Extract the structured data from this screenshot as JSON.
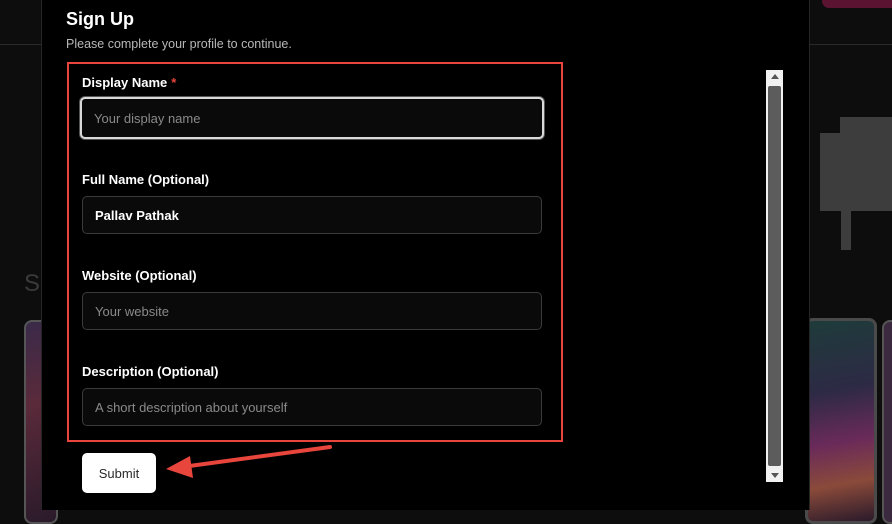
{
  "modal": {
    "title": "Sign Up",
    "subtitle": "Please complete your profile to continue."
  },
  "form": {
    "display_name": {
      "label": "Display Name",
      "required_mark": "*",
      "placeholder": "Your display name",
      "value": ""
    },
    "full_name": {
      "label": "Full Name (Optional)",
      "placeholder": "",
      "value": "Pallav Pathak"
    },
    "website": {
      "label": "Website (Optional)",
      "placeholder": "Your website",
      "value": ""
    },
    "description": {
      "label": "Description (Optional)",
      "placeholder": "A short description about yourself",
      "value": ""
    },
    "submit_label": "Submit"
  },
  "background": {
    "partial_heading": "S"
  },
  "colors": {
    "annotation": "#e8453c",
    "modal_bg": "#000000",
    "page_bg": "#0d0d0d"
  }
}
